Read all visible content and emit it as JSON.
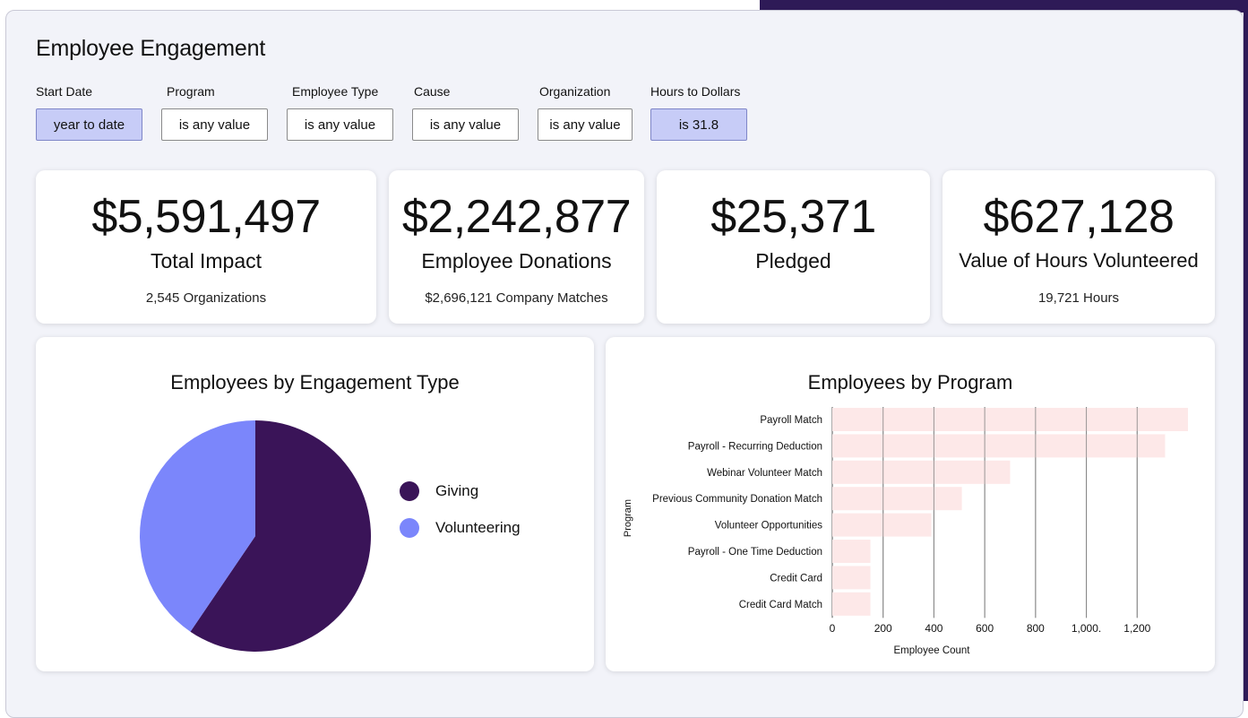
{
  "page": {
    "title": "Employee Engagement"
  },
  "filters": [
    {
      "label": "Start Date",
      "value": "year to date",
      "active": true
    },
    {
      "label": "Program",
      "value": "is any value",
      "active": false
    },
    {
      "label": "Employee Type",
      "value": "is any value",
      "active": false
    },
    {
      "label": "Cause",
      "value": "is any value",
      "active": false
    },
    {
      "label": "Organization",
      "value": "is any value",
      "active": false
    },
    {
      "label": "Hours to Dollars",
      "value": "is 31.8",
      "active": true
    }
  ],
  "kpis": [
    {
      "value": "$5,591,497",
      "label": "Total Impact",
      "sub": "2,545 Organizations"
    },
    {
      "value": "$2,242,877",
      "label": "Employee Donations",
      "sub": "$2,696,121 Company Matches"
    },
    {
      "value": "$25,371",
      "label": "Pledged",
      "sub": ""
    },
    {
      "value": "$627,128",
      "label": "Value of Hours Volunteered",
      "sub": "19,721 Hours"
    }
  ],
  "colors": {
    "giving": "#3a1458",
    "volunteering": "#7b86fb",
    "bar": "#fde8e8",
    "accent_filter": "#c7ccf7"
  },
  "chart_data": [
    {
      "type": "pie",
      "title": "Employees by Engagement Type",
      "labels": [
        "Giving",
        "Volunteering"
      ],
      "values": [
        59.5,
        40.5
      ],
      "legend": "right"
    },
    {
      "type": "bar",
      "orientation": "horizontal",
      "title": "Employees by Program",
      "categories": [
        "Payroll Match",
        "Payroll - Recurring Deduction",
        "Webinar Volunteer Match",
        "Previous Community Donation Match",
        "Volunteer Opportunities",
        "Payroll - One Time Deduction",
        "Credit Card",
        "Credit Card Match"
      ],
      "values": [
        1400,
        1310,
        700,
        510,
        390,
        150,
        150,
        150
      ],
      "xlabel": "Employee Count",
      "ylabel": "Program",
      "xticks": [
        "0",
        "200",
        "400",
        "600",
        "800",
        "1,000.",
        "1,200"
      ],
      "xlim": [
        0,
        1400
      ],
      "grid": "vertical"
    }
  ]
}
